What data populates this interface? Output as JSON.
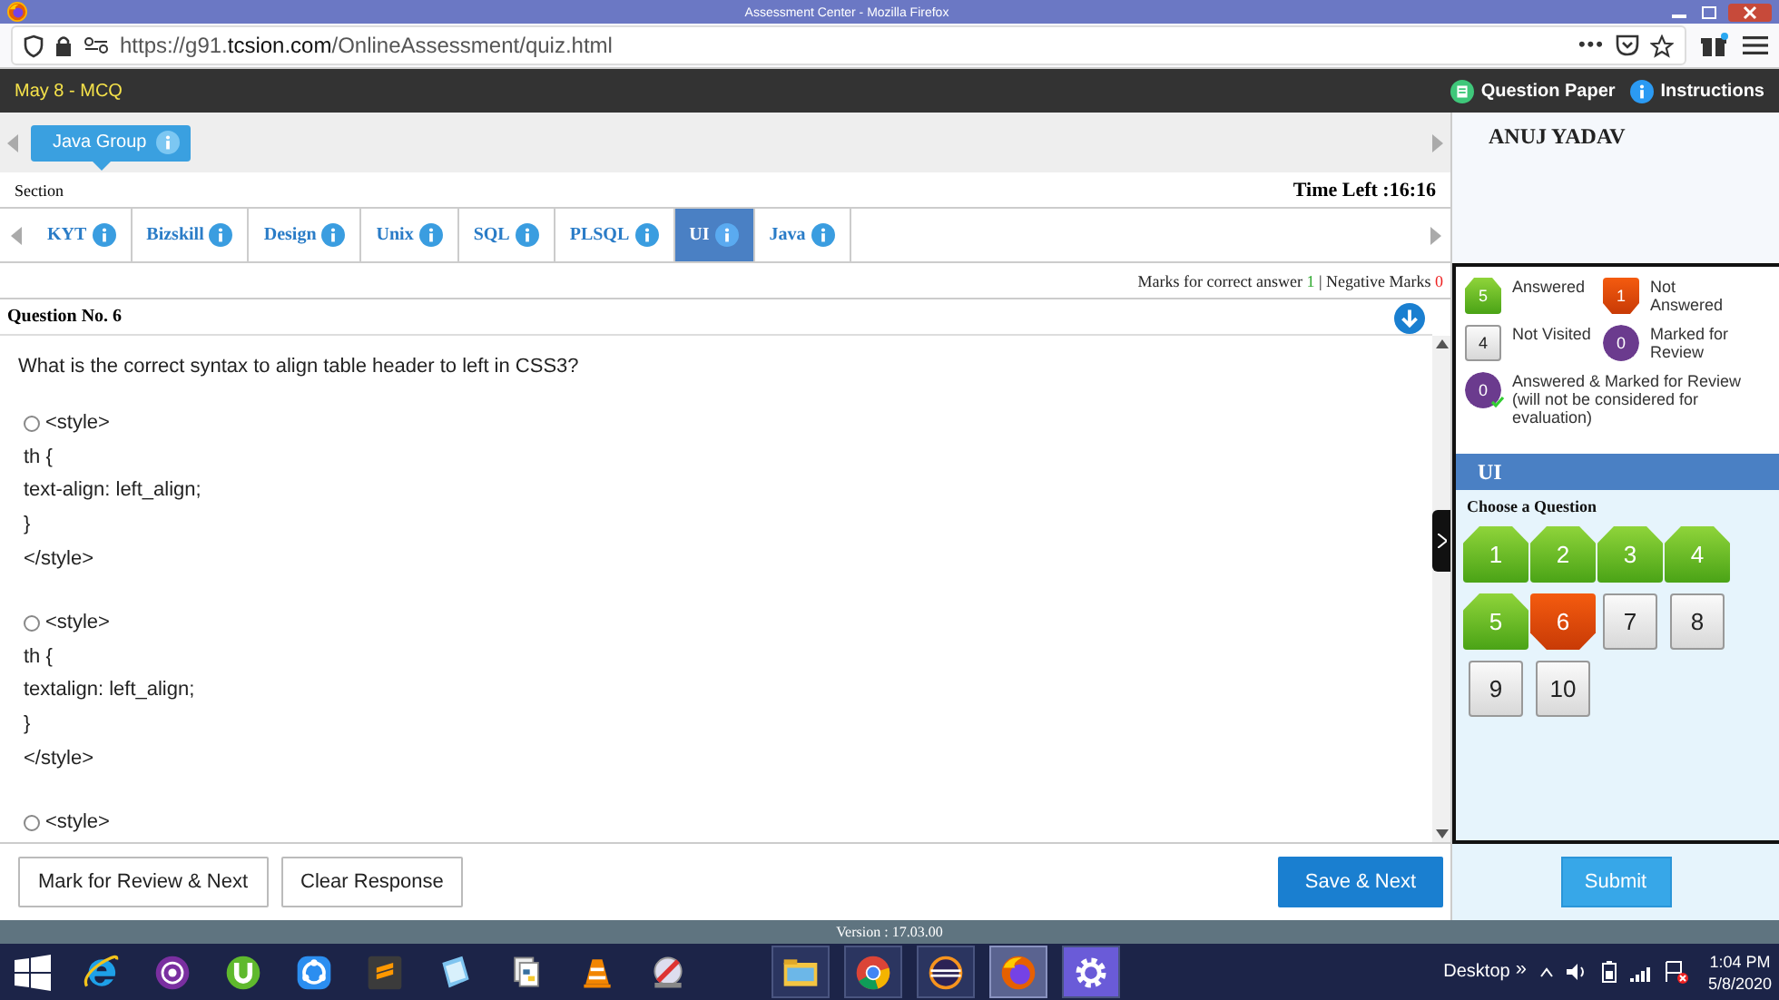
{
  "window": {
    "title": "Assessment Center - Mozilla Firefox"
  },
  "browser": {
    "url_scheme": "https://g91.",
    "url_domain": "tcsion.com",
    "url_path": "/OnlineAssessment/quiz.html",
    "more": "•••"
  },
  "header": {
    "exam": "May 8 - MCQ",
    "links": [
      {
        "kind": "paper",
        "label": "Question Paper"
      },
      {
        "kind": "info",
        "label": "Instructions"
      }
    ]
  },
  "groups": [
    {
      "label": "Java Group",
      "selected": true
    }
  ],
  "section_label": "Section",
  "time_left": "Time Left :16:16",
  "sections": [
    {
      "label": "KYT",
      "selected": false
    },
    {
      "label": "Bizskill",
      "selected": false
    },
    {
      "label": "Design",
      "selected": false
    },
    {
      "label": "Unix",
      "selected": false
    },
    {
      "label": "SQL",
      "selected": false
    },
    {
      "label": "PLSQL",
      "selected": false
    },
    {
      "label": "UI",
      "selected": true
    },
    {
      "label": "Java",
      "selected": false
    }
  ],
  "marks": {
    "correct_label": "Marks for correct answer",
    "correct": "1",
    "separator": "|",
    "negative_label": "Negative Marks",
    "negative": "0"
  },
  "question": {
    "number": "Question No. 6",
    "text": "What is the correct syntax to align table header to left in CSS3?",
    "options": [
      {
        "lines": [
          "<style>",
          "th {",
          "text-align: left_align;",
          "}",
          "</style>"
        ],
        "selected": false
      },
      {
        "lines": [
          "<style>",
          "th {",
          "textalign: left_align;",
          "}",
          "</style>"
        ],
        "selected": false
      },
      {
        "lines": [
          "<style>"
        ],
        "selected": false
      }
    ]
  },
  "buttons": {
    "mark_review": "Mark for Review & Next",
    "clear": "Clear Response",
    "save": "Save & Next",
    "submit": "Submit"
  },
  "candidate": "ANUJ YADAV",
  "legend": [
    {
      "kind": "answered",
      "count": "5",
      "label": "Answered"
    },
    {
      "kind": "not_answered",
      "count": "1",
      "label": "Not Answered"
    },
    {
      "kind": "not_visited",
      "count": "4",
      "label": "Not Visited"
    },
    {
      "kind": "marked",
      "count": "0",
      "label": "Marked for Review"
    },
    {
      "kind": "answered_marked",
      "count": "0",
      "label": "Answered & Marked for Review (will not be considered for evaluation)"
    }
  ],
  "palette": {
    "section": "UI",
    "heading": "Choose a Question",
    "questions": [
      {
        "number": "1",
        "kind": "answered"
      },
      {
        "number": "2",
        "kind": "answered"
      },
      {
        "number": "3",
        "kind": "answered"
      },
      {
        "number": "4",
        "kind": "answered"
      },
      {
        "number": "5",
        "kind": "answered"
      },
      {
        "number": "6",
        "kind": "not_answered"
      },
      {
        "number": "7",
        "kind": "not_visited"
      },
      {
        "number": "8",
        "kind": "not_visited"
      },
      {
        "number": "9",
        "kind": "not_visited"
      },
      {
        "number": "10",
        "kind": "not_visited"
      }
    ]
  },
  "version": "Version : 17.03.00",
  "taskbar": {
    "pinned": [
      {
        "kind": "ie"
      },
      {
        "kind": "tor"
      },
      {
        "kind": "torrent"
      },
      {
        "kind": "share"
      },
      {
        "kind": "sublime"
      },
      {
        "kind": "notes"
      },
      {
        "kind": "python"
      },
      {
        "kind": "vlc"
      },
      {
        "kind": "tool"
      }
    ],
    "running": [
      {
        "kind": "explorer",
        "selected": false
      },
      {
        "kind": "chrome",
        "selected": false
      },
      {
        "kind": "eclipse",
        "selected": false
      },
      {
        "kind": "firefox",
        "selected": true
      },
      {
        "kind": "settings",
        "selected": false
      }
    ],
    "desktop": "Desktop",
    "chevron": "»",
    "time": "1:04 PM",
    "date": "5/8/2020"
  }
}
